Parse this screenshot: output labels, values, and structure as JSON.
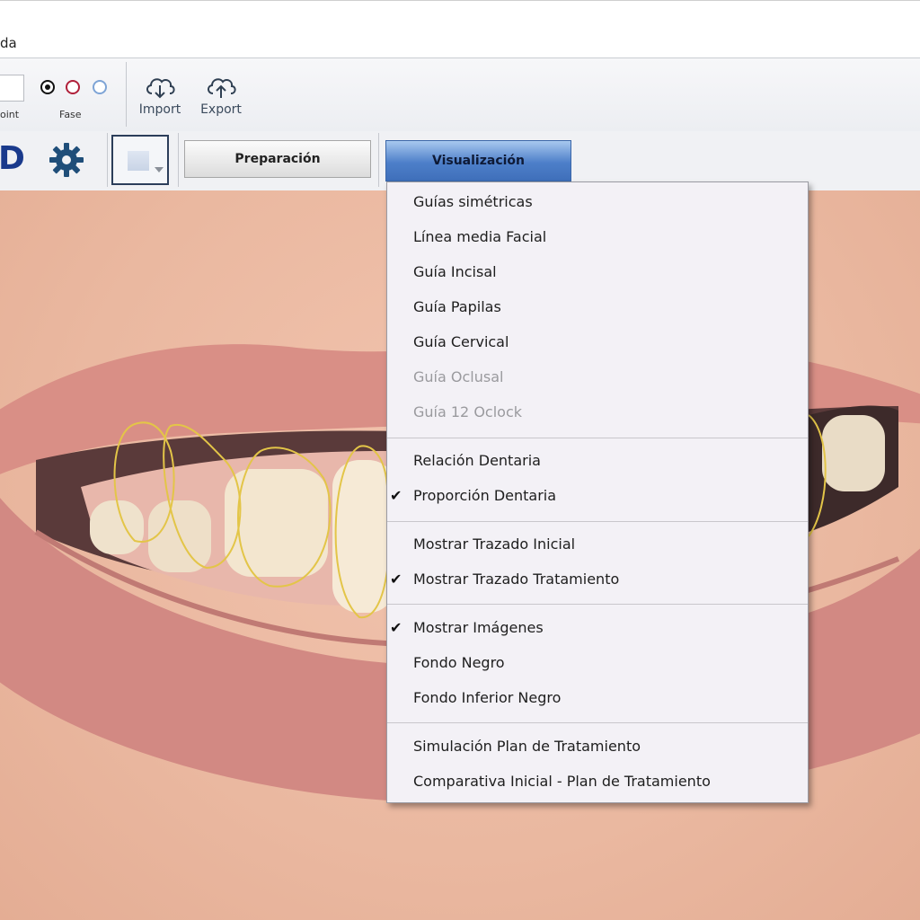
{
  "menubar": {
    "help_fragment": "da"
  },
  "ribbon": {
    "point_label": "oint",
    "fase_label": "Fase",
    "import_label": "Import",
    "export_label": "Export",
    "logo_text": "D",
    "colors": {
      "black": "#111111",
      "red": "#b0203a",
      "blue": "#7ea4d6"
    }
  },
  "tabs": {
    "preparacion": "Preparación",
    "visualizacion": "Visualización",
    "active": "Visualización"
  },
  "menu": {
    "items": [
      {
        "label": "Guías simétricas",
        "checked": false,
        "enabled": true
      },
      {
        "label": "Línea media Facial",
        "checked": false,
        "enabled": true
      },
      {
        "label": "Guía Incisal",
        "checked": false,
        "enabled": true
      },
      {
        "label": "Guía Papilas",
        "checked": false,
        "enabled": true
      },
      {
        "label": "Guía Cervical",
        "checked": false,
        "enabled": true
      },
      {
        "label": "Guía Oclusal",
        "checked": false,
        "enabled": false
      },
      {
        "label": "Guía 12 Oclock",
        "checked": false,
        "enabled": false
      },
      {
        "label": "Relación Dentaria",
        "checked": false,
        "enabled": true
      },
      {
        "label": "Proporción Dentaria",
        "checked": true,
        "enabled": true
      },
      {
        "label": "Mostrar Trazado Inicial",
        "checked": false,
        "enabled": true
      },
      {
        "label": "Mostrar Trazado Tratamiento",
        "checked": true,
        "enabled": true
      },
      {
        "label": "Mostrar Imágenes",
        "checked": true,
        "enabled": true
      },
      {
        "label": "Fondo Negro",
        "checked": false,
        "enabled": true
      },
      {
        "label": "Fondo Inferior Negro",
        "checked": false,
        "enabled": true
      },
      {
        "label": "Simulación Plan de Tratamiento",
        "checked": false,
        "enabled": true
      },
      {
        "label": "Comparativa Inicial - Plan de Tratamiento",
        "checked": false,
        "enabled": true
      }
    ],
    "check_glyph": "✔"
  },
  "icons": {
    "gear": "gear-icon",
    "import": "cloud-download-icon",
    "export": "cloud-upload-icon"
  }
}
